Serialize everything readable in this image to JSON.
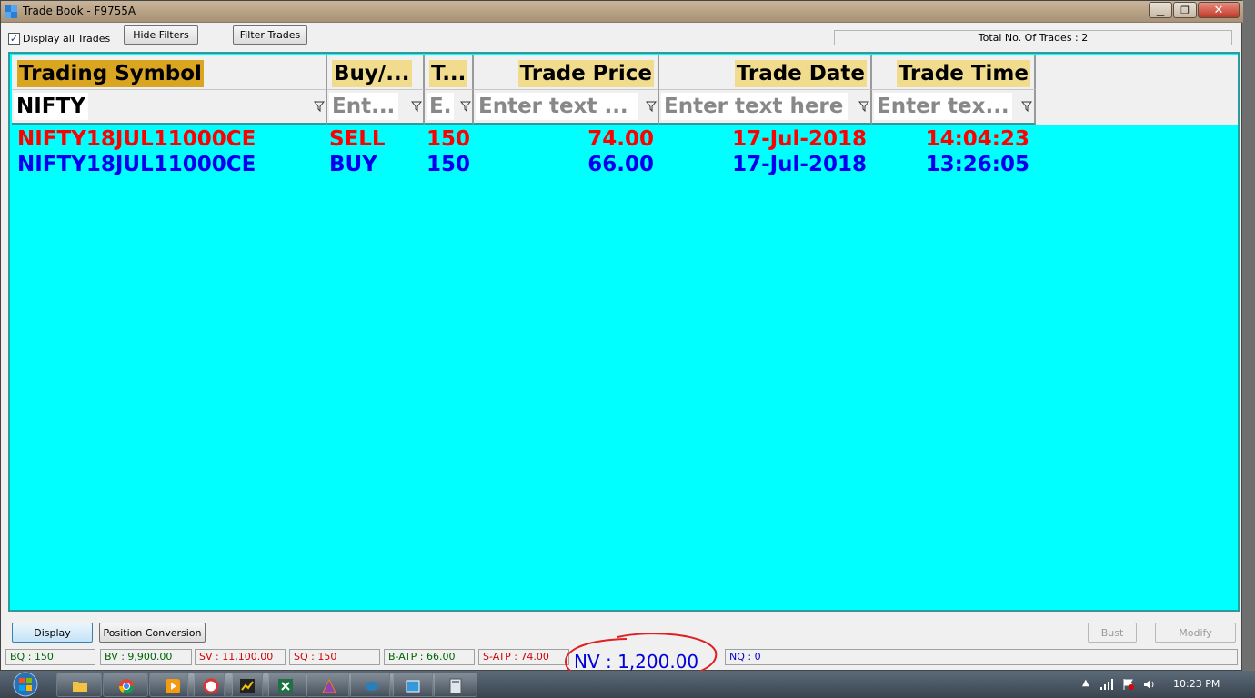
{
  "window": {
    "title": "Trade Book - F9755A"
  },
  "toolbar": {
    "display_all_label": "Display all Trades",
    "display_all_checked": true,
    "hide_filters_label": "Hide Filters",
    "filter_trades_label": "Filter Trades",
    "total_trades_text": "Total No. Of Trades : 2"
  },
  "table": {
    "columns": [
      "Trading Symbol",
      "Buy/...",
      "T...",
      "Trade Price",
      "Trade Date",
      "Trade Time"
    ],
    "filters": {
      "symbol_value": "NIFTY",
      "buysell_placeholder": "Ent...",
      "qty_placeholder": "E.",
      "price_placeholder": "Enter text ...",
      "date_placeholder": "Enter text here",
      "time_placeholder": "Enter tex..."
    },
    "rows": [
      {
        "symbol": "NIFTY18JUL11000CE",
        "side": "SELL",
        "qty": "150",
        "price": "74.00",
        "date": "17-Jul-2018",
        "time": "14:04:23",
        "color": "#ff0000"
      },
      {
        "symbol": "NIFTY18JUL11000CE",
        "side": "BUY",
        "qty": "150",
        "price": "66.00",
        "date": "17-Jul-2018",
        "time": "13:26:05",
        "color": "#0000ee"
      }
    ],
    "grid_background": "#00ffff"
  },
  "bottom": {
    "display_label": "Display",
    "position_conversion_label": "Position Conversion",
    "bust_label": "Bust",
    "modify_label": "Modify"
  },
  "status": {
    "bq": "BQ : 150",
    "bv": "BV : 9,900.00",
    "sv": "SV : 11,100.00",
    "sq": "SQ : 150",
    "batp": "B-ATP : 66.00",
    "satp": "S-ATP : 74.00",
    "nv": "NV : 1,200.00",
    "nq": "NQ : 0"
  },
  "taskbar": {
    "clock": "10:23 PM"
  }
}
